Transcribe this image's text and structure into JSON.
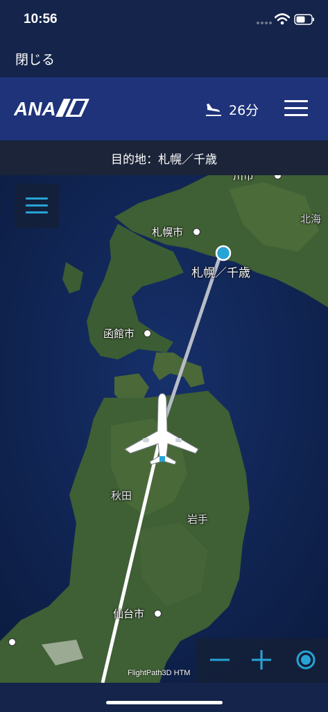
{
  "status_bar": {
    "time": "10:56",
    "icons": [
      "cellular-signal-icon",
      "wifi-icon",
      "battery-icon"
    ]
  },
  "close_bar": {
    "close_label": "閉じる"
  },
  "header": {
    "logo_text": "ANA",
    "eta_icon": "airplane-landing-icon",
    "eta": "26分",
    "menu_icon": "hamburger-menu-icon"
  },
  "destination": {
    "text": "目的地：札幌／千歳"
  },
  "map": {
    "labels": {
      "asahikawa": "川市",
      "sapporo": "札幌市",
      "hokkaido": "北海",
      "destination": "札幌／千歳",
      "hakodate": "函館市",
      "akita": "秋田",
      "iwate": "岩手",
      "sendai": "仙台市"
    },
    "attribution": "FlightPath3D HTM",
    "controls": [
      "zoom-out-icon",
      "zoom-in-icon",
      "recenter-icon"
    ]
  },
  "colors": {
    "status_bg": "#14244a",
    "header_bg": "#1e3379",
    "destination_bg": "#1b2438",
    "accent_cyan": "#27a4d6",
    "sea": "#0e2148",
    "land": "#3f5f34"
  }
}
